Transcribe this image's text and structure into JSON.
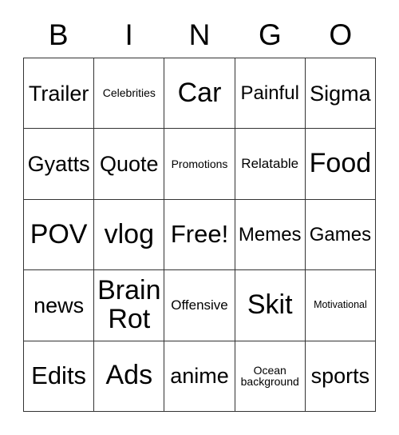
{
  "card": {
    "headers": [
      "B",
      "I",
      "N",
      "G",
      "O"
    ],
    "rows": [
      [
        {
          "text": "Trailer",
          "size": "l"
        },
        {
          "text": "Celebrities",
          "size": "xs"
        },
        {
          "text": "Car",
          "size": "xxl"
        },
        {
          "text": "Painful",
          "size": "m"
        },
        {
          "text": "Sigma",
          "size": "l"
        }
      ],
      [
        {
          "text": "Gyatts",
          "size": "l"
        },
        {
          "text": "Quote",
          "size": "l"
        },
        {
          "text": "Promotions",
          "size": "xs"
        },
        {
          "text": "Relatable",
          "size": "s"
        },
        {
          "text": "Food",
          "size": "xxl"
        }
      ],
      [
        {
          "text": "POV",
          "size": "xxl"
        },
        {
          "text": "vlog",
          "size": "xxl"
        },
        {
          "text": "Free!",
          "size": "xl"
        },
        {
          "text": "Memes",
          "size": "m"
        },
        {
          "text": "Games",
          "size": "m"
        }
      ],
      [
        {
          "text": "news",
          "size": "l"
        },
        {
          "text": "Brain Rot",
          "size": "xxl"
        },
        {
          "text": "Offensive",
          "size": "s"
        },
        {
          "text": "Skit",
          "size": "xxl"
        },
        {
          "text": "Motivational",
          "size": "xxs"
        }
      ],
      [
        {
          "text": "Edits",
          "size": "xl"
        },
        {
          "text": "Ads",
          "size": "xxl"
        },
        {
          "text": "anime",
          "size": "l"
        },
        {
          "text": "Ocean background",
          "size": "xs"
        },
        {
          "text": "sports",
          "size": "l"
        }
      ]
    ]
  },
  "colors": {
    "border": "#333333",
    "text": "#000000",
    "background": "#ffffff"
  }
}
